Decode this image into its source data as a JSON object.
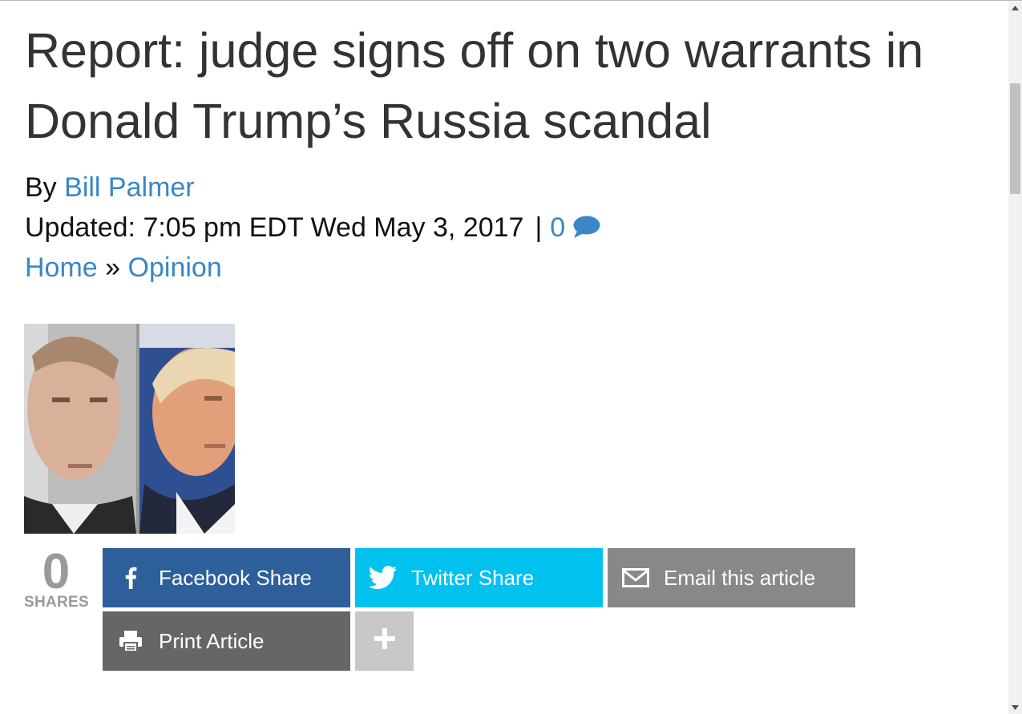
{
  "article": {
    "title": "Report: judge signs off on two warrants in Donald Trump’s Russia scandal",
    "byline_prefix": "By",
    "author": "Bill Palmer",
    "updated": "Updated: 7:05 pm EDT Wed May 3, 2017",
    "separator": "|",
    "comment_count": "0",
    "comment_icon": "speech-bubble-icon"
  },
  "breadcrumb": {
    "home": "Home",
    "separator": "»",
    "section": "Opinion"
  },
  "share": {
    "count": "0",
    "count_label": "SHARES",
    "facebook_label": "Facebook Share",
    "twitter_label": "Twitter Share",
    "email_label": "Email this article",
    "print_label": "Print Article",
    "more_icon": "plus-icon",
    "colors": {
      "facebook": "#2d5f9a",
      "twitter": "#01c1ef",
      "email": "#888888",
      "print": "#666666",
      "more": "#c8c8c8"
    }
  },
  "colors": {
    "link": "#3a86c6",
    "title": "#333333"
  }
}
